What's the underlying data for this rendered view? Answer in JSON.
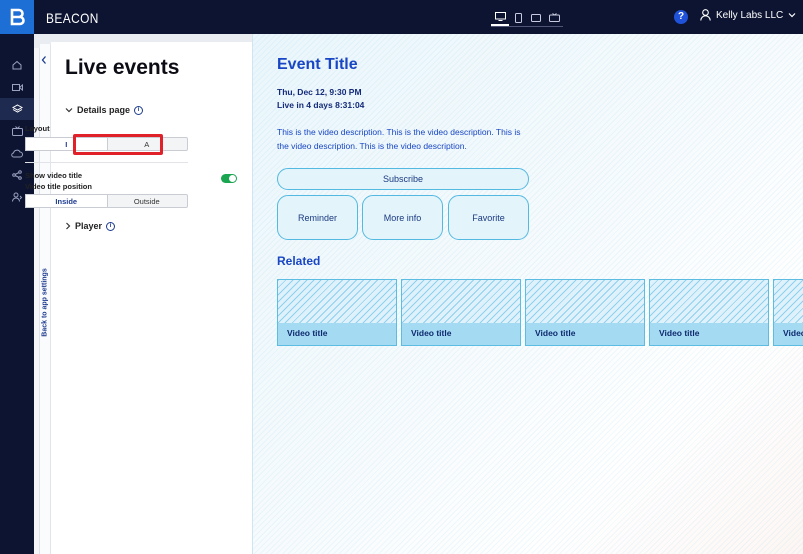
{
  "app": {
    "brand": "BEACON"
  },
  "topbar": {
    "help_label": "?",
    "account_name": "Kelly Labs LLC",
    "devices": [
      "desktop",
      "mobile",
      "tablet",
      "tv"
    ]
  },
  "rail": {
    "icons": [
      "home-icon",
      "video-icon",
      "layers-icon",
      "tv-icon",
      "cloud-icon",
      "share-icon",
      "user-icon"
    ],
    "active_index": 2
  },
  "back": {
    "label": "Back to app settings"
  },
  "panel": {
    "title": "Live events",
    "details_section": "Details page",
    "layout_label": "Layout",
    "layout_options": [
      "I",
      "A"
    ],
    "layout_selected": "I",
    "show_title_label": "Show video title",
    "show_title_on": true,
    "title_position_label": "Video title position",
    "position_options": [
      "Inside",
      "Outside"
    ],
    "position_selected": "Inside",
    "player_section": "Player"
  },
  "preview": {
    "title": "Event Title",
    "date": "Thu, Dec 12, 9:30 PM",
    "countdown": "Live in 4 days 8:31:04",
    "description": "This is the video description. This is the video description. This is the video description. This is the video description.",
    "subscribe": "Subscribe",
    "reminder": "Reminder",
    "more_info": "More info",
    "favorite": "Favorite",
    "related_heading": "Related",
    "cards": [
      "Video title",
      "Video title",
      "Video title",
      "Video title",
      "Video title"
    ]
  },
  "colors": {
    "nav": "#0d1431",
    "accent": "#1846c4",
    "highlight": "#e0212a",
    "toggle": "#1aa551"
  }
}
